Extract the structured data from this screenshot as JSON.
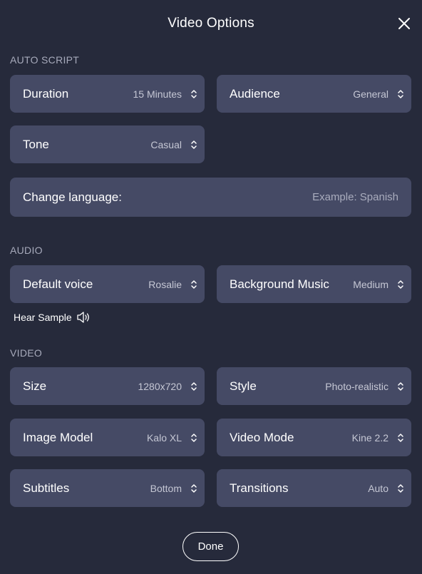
{
  "dialog": {
    "title": "Video Options"
  },
  "sections": {
    "auto_script": "AUTO SCRIPT",
    "audio": "AUDIO",
    "video": "VIDEO"
  },
  "auto_script": {
    "duration": {
      "label": "Duration",
      "value": "15 Minutes"
    },
    "audience": {
      "label": "Audience",
      "value": "General"
    },
    "tone": {
      "label": "Tone",
      "value": "Casual"
    },
    "language": {
      "label": "Change language:",
      "placeholder": "Example: Spanish"
    }
  },
  "audio": {
    "voice": {
      "label": "Default voice",
      "value": "Rosalie"
    },
    "music": {
      "label": "Background Music",
      "value": "Medium"
    },
    "sample_label": "Hear Sample"
  },
  "video": {
    "size": {
      "label": "Size",
      "value": "1280x720"
    },
    "style": {
      "label": "Style",
      "value": "Photo-realistic"
    },
    "image_model": {
      "label": "Image Model",
      "value": "Kalo XL"
    },
    "video_mode": {
      "label": "Video Mode",
      "value": "Kine 2.2"
    },
    "subtitles": {
      "label": "Subtitles",
      "value": "Bottom"
    },
    "transitions": {
      "label": "Transitions",
      "value": "Auto"
    }
  },
  "footer": {
    "done_label": "Done"
  },
  "icons": {
    "close": "close-icon",
    "chevron": "chevron-up-down-icon",
    "speaker": "speaker-icon"
  },
  "colors": {
    "background": "#262a3b",
    "field": "#454a65",
    "section_label": "#a7aabb",
    "text": "#ffffff"
  }
}
